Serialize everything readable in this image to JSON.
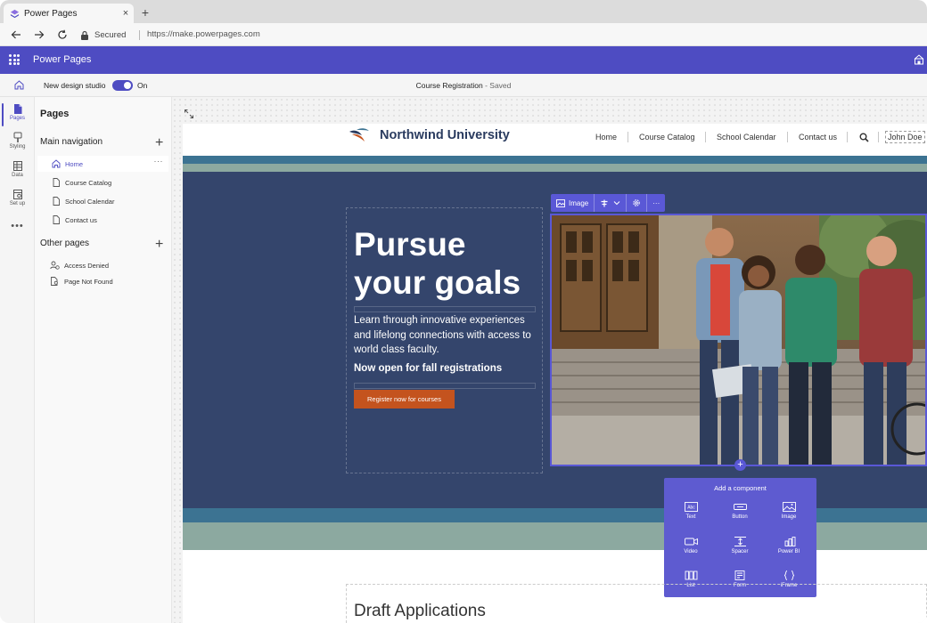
{
  "browser": {
    "tab_title": "Power Pages",
    "close_glyph": "×",
    "new_tab_glyph": "+",
    "secured_label": "Secured",
    "url": "https://make.powerpages.com"
  },
  "app": {
    "name": "Power Pages",
    "accent": "#4e4cc2"
  },
  "command_bar": {
    "new_design_studio_label": "New design studio",
    "toggle_state": "On",
    "document_name": "Course Registration",
    "document_status": " - Saved"
  },
  "rail": {
    "items": [
      {
        "label": "Pages",
        "icon": "pages-icon"
      },
      {
        "label": "Styling",
        "icon": "styling-icon"
      },
      {
        "label": "Data",
        "icon": "data-icon"
      },
      {
        "label": "Set up",
        "icon": "setup-icon"
      }
    ],
    "more_glyph": "•••"
  },
  "pages_panel": {
    "title": "Pages",
    "main_nav_label": "Main navigation",
    "main_nav": [
      "Home",
      "Course Catalog",
      "School Calendar",
      "Contact us"
    ],
    "other_pages_label": "Other pages",
    "other_pages": [
      "Access Denied",
      "Page Not Found"
    ],
    "plus_glyph": "+",
    "more_glyph": "···"
  },
  "site": {
    "brand": "Northwind University",
    "nav": [
      "Home",
      "Course Catalog",
      "School Calendar",
      "Contact us"
    ],
    "user": "John Doe",
    "hero_title": "Pursue your goals",
    "hero_body": "Learn through innovative experiences and lifelong connections with access to world class faculty.",
    "hero_strong": "Now open for fall registrations",
    "cta": "Register now for courses",
    "draft_title": "Draft Applications",
    "colors": {
      "hero_bg": "#34456c",
      "band_blue": "#3c7392",
      "band_sage": "#8ca9a0",
      "cta": "#c4531e"
    }
  },
  "image_toolbar": {
    "image_label": "Image",
    "more_glyph": "···"
  },
  "add_component": {
    "add_glyph": "+",
    "title": "Add a component",
    "items": [
      "Text",
      "Button",
      "Image",
      "Video",
      "Spacer",
      "Power BI",
      "List",
      "Form",
      "iFrame"
    ]
  }
}
